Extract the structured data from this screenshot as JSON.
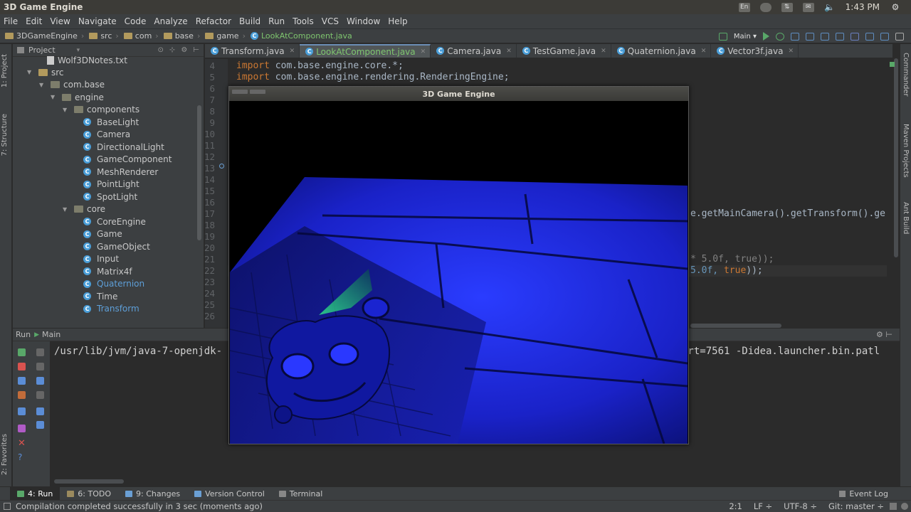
{
  "system": {
    "window_title": "3D Game Engine",
    "keyboard": "En",
    "time": "1:43 PM"
  },
  "menu": [
    "File",
    "Edit",
    "View",
    "Navigate",
    "Code",
    "Analyze",
    "Refactor",
    "Build",
    "Run",
    "Tools",
    "VCS",
    "Window",
    "Help"
  ],
  "breadcrumbs": [
    "3DGameEngine",
    "src",
    "com",
    "base",
    "game",
    "LookAtComponent.java"
  ],
  "run_config": "Main",
  "project_panel": {
    "title": "Project",
    "tree": [
      {
        "label": "Wolf3DNotes.txt",
        "kind": "text",
        "depth": 3
      },
      {
        "label": "src",
        "kind": "folder",
        "depth": 1,
        "expanded": true
      },
      {
        "label": "com.base",
        "kind": "package",
        "depth": 2,
        "expanded": true
      },
      {
        "label": "engine",
        "kind": "package",
        "depth": 3,
        "expanded": true
      },
      {
        "label": "components",
        "kind": "package",
        "depth": 4,
        "expanded": true
      },
      {
        "label": "BaseLight",
        "kind": "class",
        "depth": 5
      },
      {
        "label": "Camera",
        "kind": "class",
        "depth": 5
      },
      {
        "label": "DirectionalLight",
        "kind": "class",
        "depth": 5
      },
      {
        "label": "GameComponent",
        "kind": "class",
        "depth": 5
      },
      {
        "label": "MeshRenderer",
        "kind": "class",
        "depth": 5
      },
      {
        "label": "PointLight",
        "kind": "class",
        "depth": 5
      },
      {
        "label": "SpotLight",
        "kind": "class",
        "depth": 5
      },
      {
        "label": "core",
        "kind": "package",
        "depth": 4,
        "expanded": true
      },
      {
        "label": "CoreEngine",
        "kind": "class",
        "depth": 5
      },
      {
        "label": "Game",
        "kind": "class",
        "depth": 5
      },
      {
        "label": "GameObject",
        "kind": "class",
        "depth": 5
      },
      {
        "label": "Input",
        "kind": "class",
        "depth": 5
      },
      {
        "label": "Matrix4f",
        "kind": "class",
        "depth": 5
      },
      {
        "label": "Quaternion",
        "kind": "class",
        "depth": 5,
        "modified": true
      },
      {
        "label": "Time",
        "kind": "class",
        "depth": 5
      },
      {
        "label": "Transform",
        "kind": "class",
        "depth": 5,
        "modified": true
      }
    ]
  },
  "editor_tabs": [
    {
      "label": "Transform.java",
      "active": false
    },
    {
      "label": "LookAtComponent.java",
      "active": true
    },
    {
      "label": "Camera.java",
      "active": false
    },
    {
      "label": "TestGame.java",
      "active": false
    },
    {
      "label": "Quaternion.java",
      "active": false
    },
    {
      "label": "Vector3f.java",
      "active": false
    }
  ],
  "editor": {
    "line_numbers": [
      "4",
      "5",
      "6",
      "7",
      "8",
      "9",
      "10",
      "11",
      "12",
      "13",
      "14",
      "15",
      "16",
      "17",
      "18",
      "19",
      "20",
      "21",
      "22",
      "23",
      "24",
      "25",
      "26"
    ],
    "line4_kw": "import",
    "line4_rest": " com.base.engine.core.*;",
    "line5_kw": "import",
    "line5_rest": " com.base.engine.rendering.RenderingEngine;",
    "line17_frag": "e.getMainCamera().getTransform().ge",
    "line21_frag": "* 5.0f, true));",
    "line22_pre": "5.0f, ",
    "line22_kw": "true",
    "line22_post": "));"
  },
  "run_panel": {
    "label": "Run",
    "config": "Main",
    "output_left": "/usr/lib/jvm/java-7-openjdk-",
    "output_right": "ort=7561 -Didea.launcher.bin.patl"
  },
  "game_window": {
    "title": "3D Game Engine"
  },
  "left_strip": [
    "1: Project",
    "7: Structure",
    "2: Favorites"
  ],
  "right_strip": [
    "Commander",
    "Maven Projects",
    "Ant Build"
  ],
  "bottom_tabs": [
    {
      "label": "4: Run",
      "active": true,
      "color": "#59a869"
    },
    {
      "label": "6: TODO",
      "active": false,
      "color": "#9b8a5e"
    },
    {
      "label": "9: Changes",
      "active": false,
      "color": "#6a9fd4"
    },
    {
      "label": "Version Control",
      "active": false,
      "color": "#6a9fd4"
    },
    {
      "label": "Terminal",
      "active": false,
      "color": "#888888"
    }
  ],
  "event_log": "Event Log",
  "status": {
    "message": "Compilation completed successfully in 3 sec (moments ago)",
    "position": "2:1",
    "line_sep": "LF",
    "encoding": "UTF-8",
    "vcs": "Git: master"
  }
}
